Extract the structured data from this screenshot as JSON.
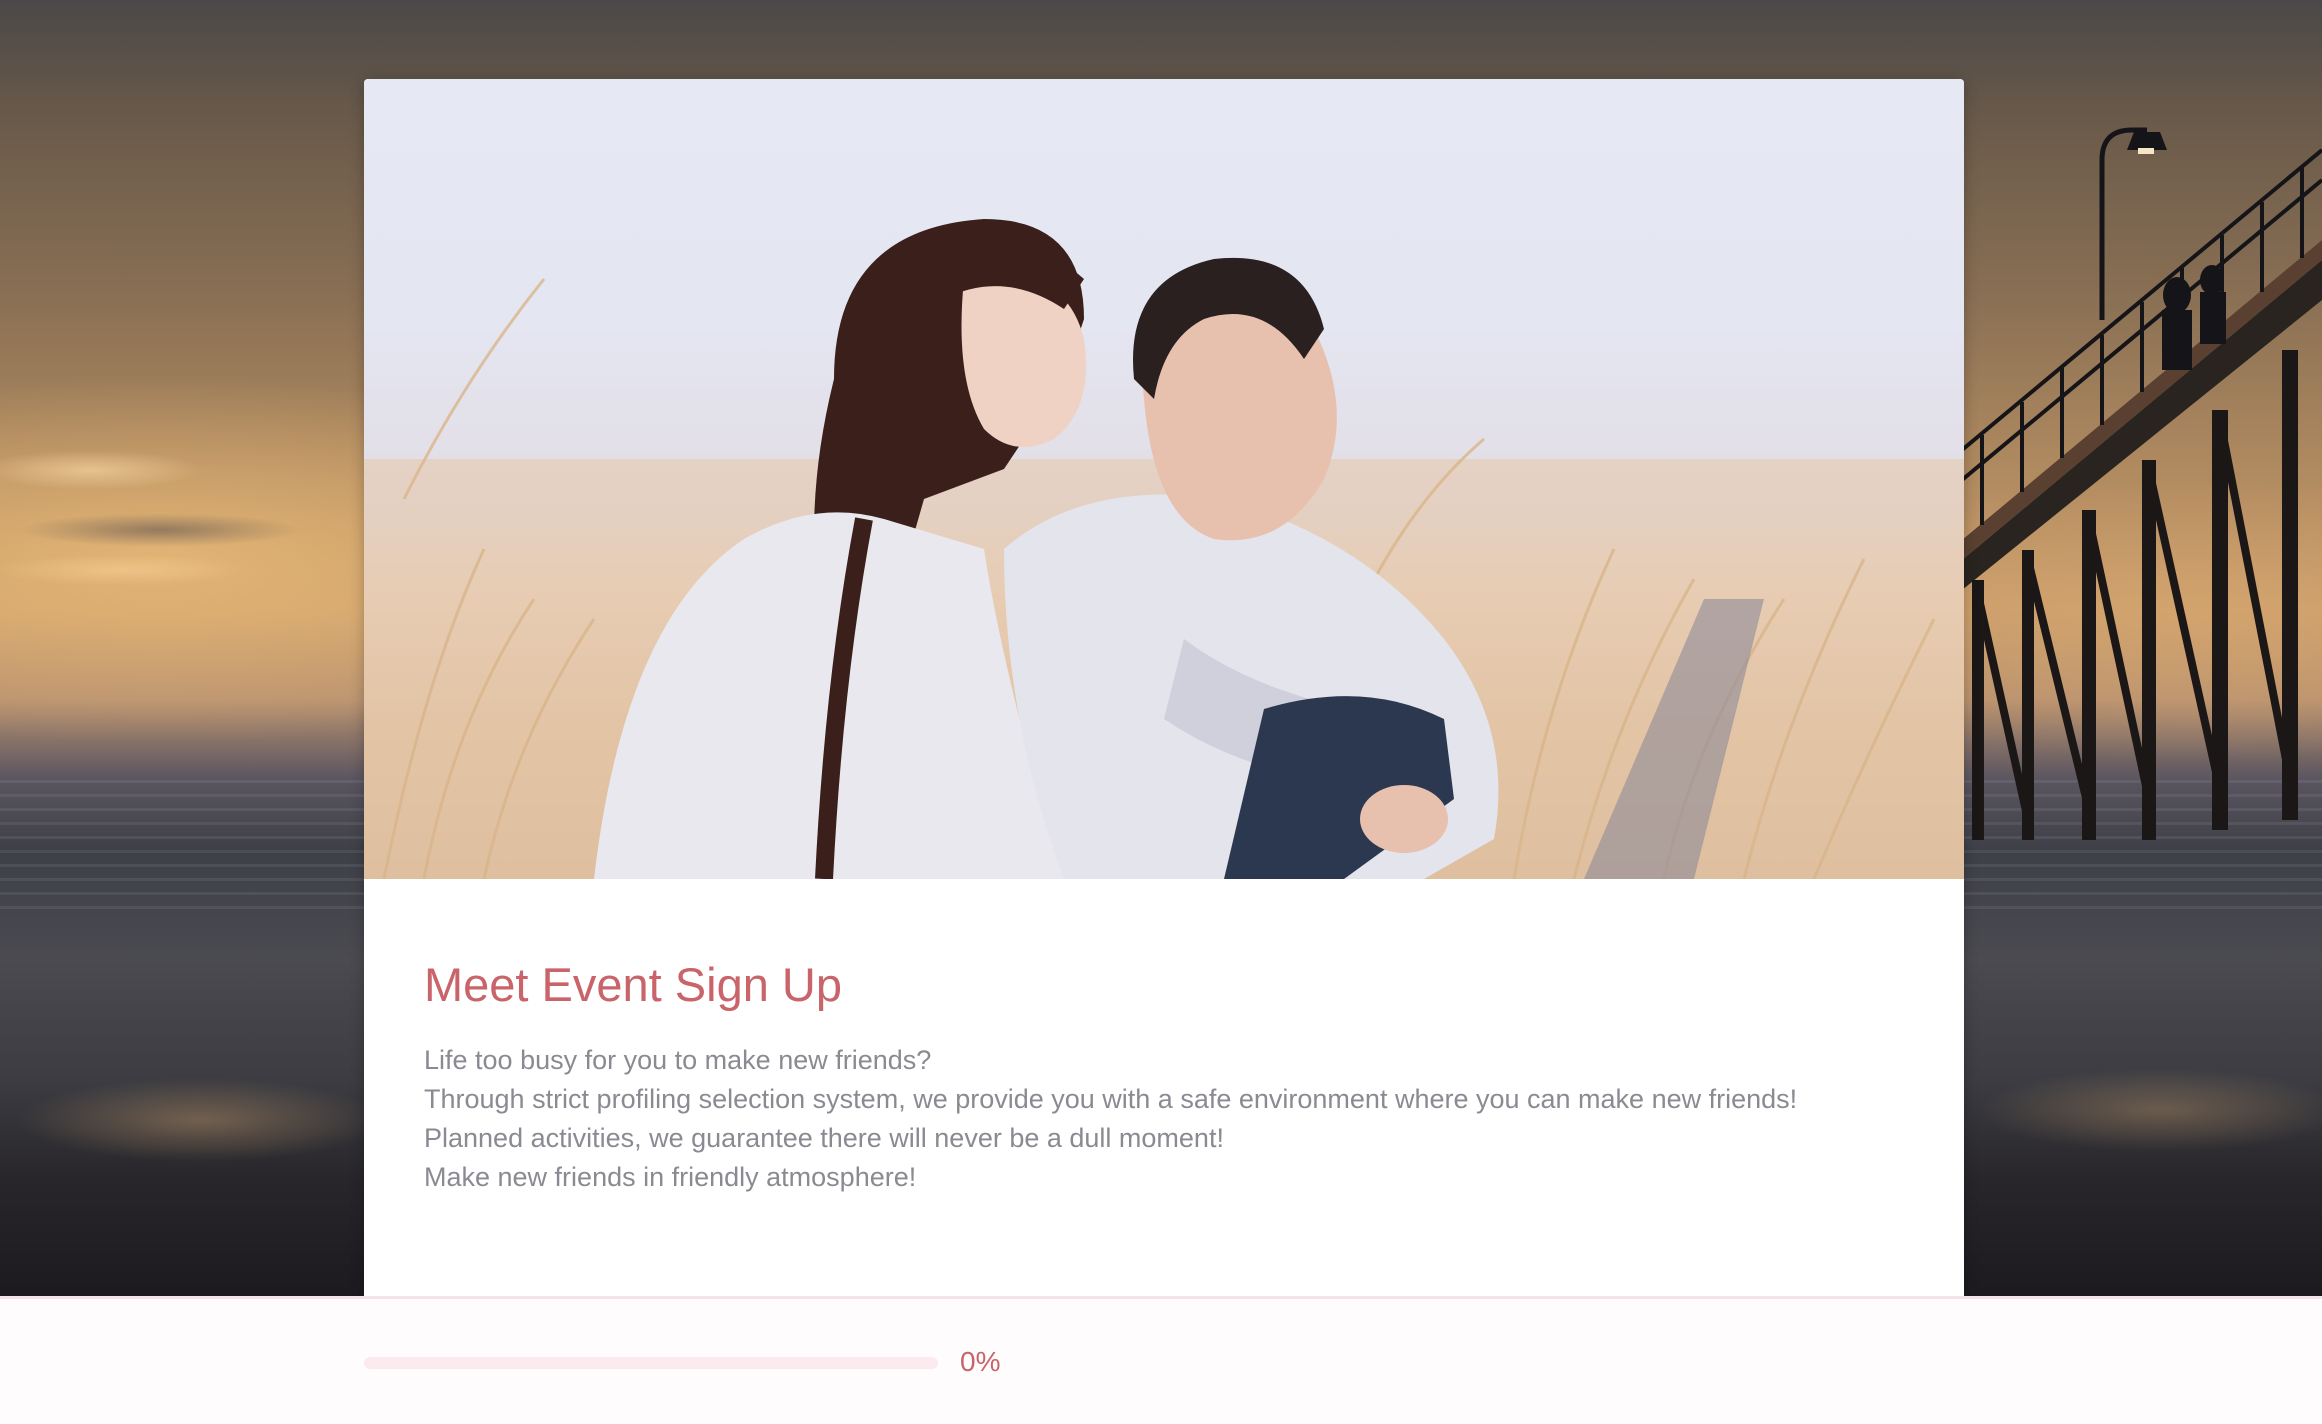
{
  "form": {
    "title": "Meet Event Sign Up",
    "description": [
      "Life too busy for you to make new friends?",
      "Through strict profiling selection system, we provide you with a safe environment where you can make new friends!",
      "Planned activities, we guarantee there will never be a dull moment!",
      "Make new friends in friendly atmosphere!"
    ]
  },
  "progress": {
    "value": 0,
    "label": "0%"
  },
  "colors": {
    "accent": "#c8646a",
    "text_muted": "#8a8a92",
    "progress_track": "#fbeaee"
  },
  "images": {
    "background": "beach-sunset-with-pier-photo",
    "hero": "laughing-couple-in-dry-grass-photo"
  }
}
